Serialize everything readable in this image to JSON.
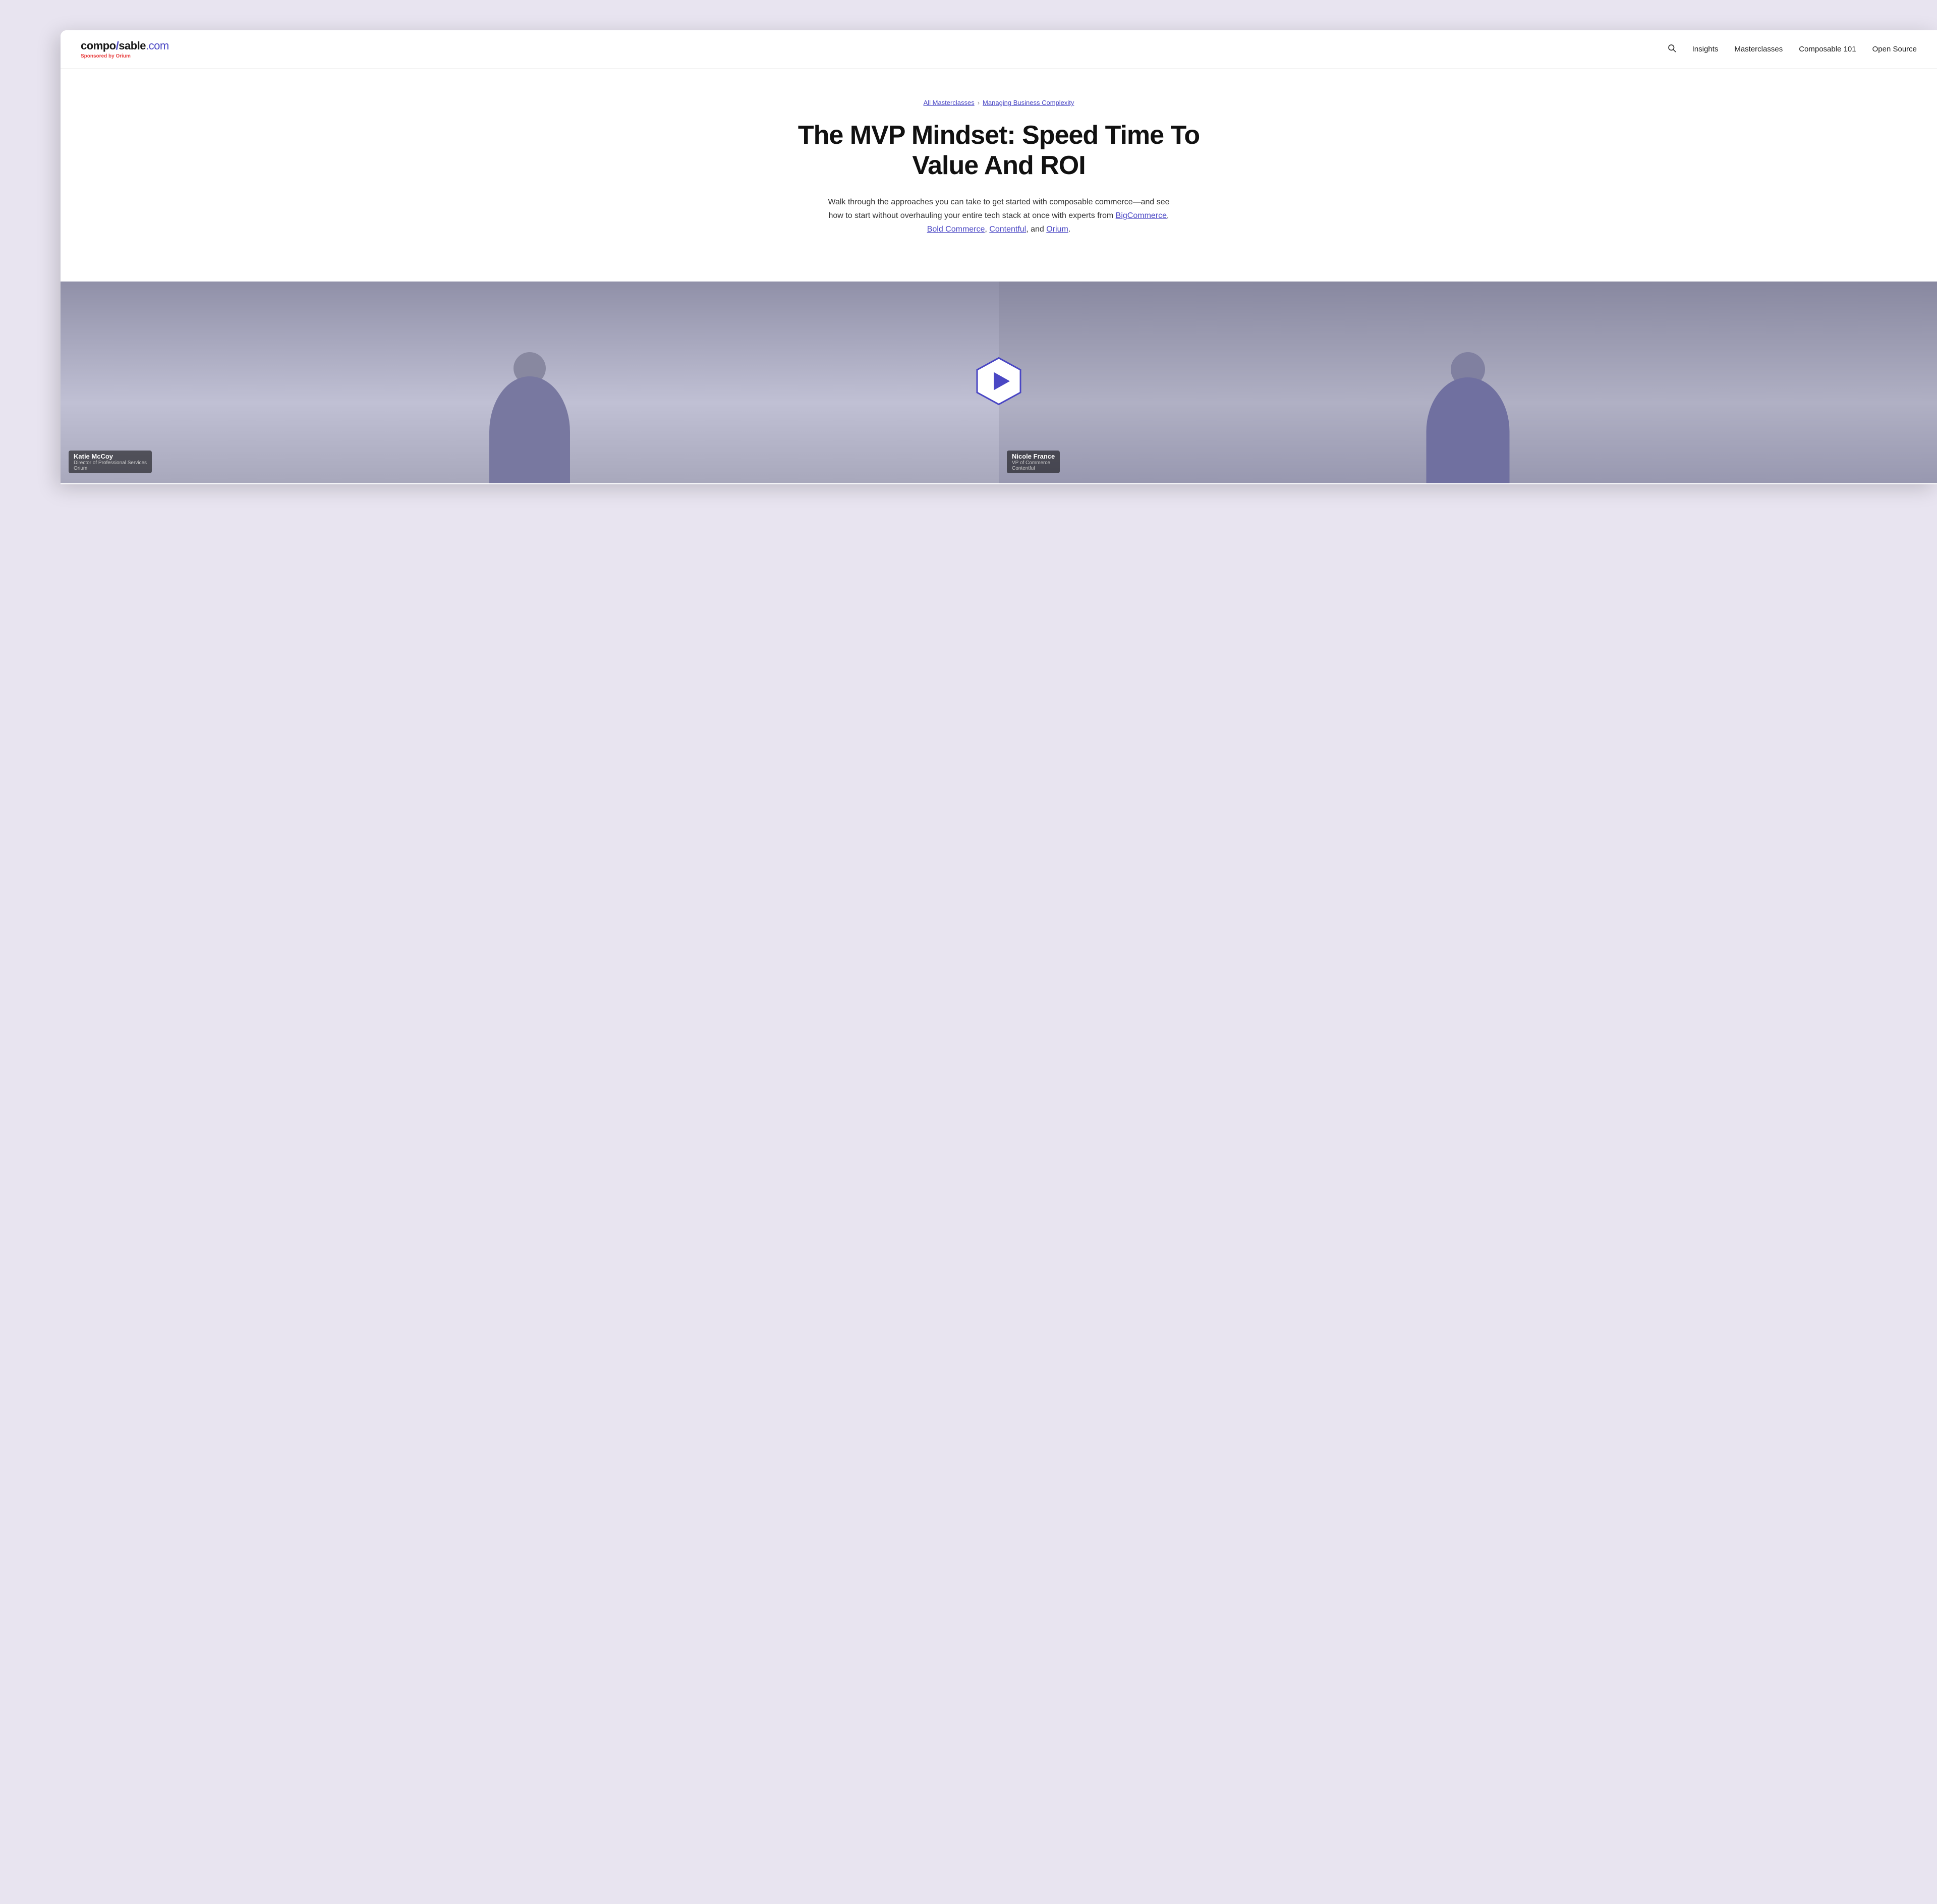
{
  "brand": {
    "logo_prefix": "compo",
    "logo_slash": "/",
    "logo_suffix": "sable",
    "logo_dot_com": ".com",
    "sponsored_label": "Sponsored by",
    "sponsor_name": "Orium"
  },
  "nav": {
    "search_label": "Search",
    "links": [
      {
        "id": "insights",
        "label": "Insights"
      },
      {
        "id": "masterclasses",
        "label": "Masterclasses"
      },
      {
        "id": "composable101",
        "label": "Composable 101"
      },
      {
        "id": "opensource",
        "label": "Open Source"
      }
    ]
  },
  "breadcrumb": {
    "parent_label": "All Masterclasses",
    "separator": "›",
    "current_label": "Managing Business Complexity"
  },
  "hero": {
    "title": "The MVP Mindset: Speed Time To Value And ROI",
    "description_part1": "Walk through the approaches you can take to get started with composable commerce—and see how to start without overhauling your entire tech stack at once with experts from",
    "link1": "BigCommerce",
    "description_part2": ",",
    "link2": "Bold Commerce",
    "description_part3": ",",
    "link3": "Contentful",
    "description_part4": ", and",
    "link4": "Orium",
    "description_end": "."
  },
  "video": {
    "participant_left": {
      "name": "Katie McCoy",
      "role": "Director of Professional Services",
      "company": "Orium"
    },
    "participant_right": {
      "name": "Nicole France",
      "role": "VP of Commerce",
      "company": "Contentful"
    },
    "play_button_label": "Play video"
  },
  "colors": {
    "brand_blue": "#4a47c4",
    "text_dark": "#111111",
    "text_gray": "#333333",
    "bg_lavender": "#e8e4f0",
    "bg_white": "#ffffff",
    "video_bg": "#c0c0d4"
  }
}
